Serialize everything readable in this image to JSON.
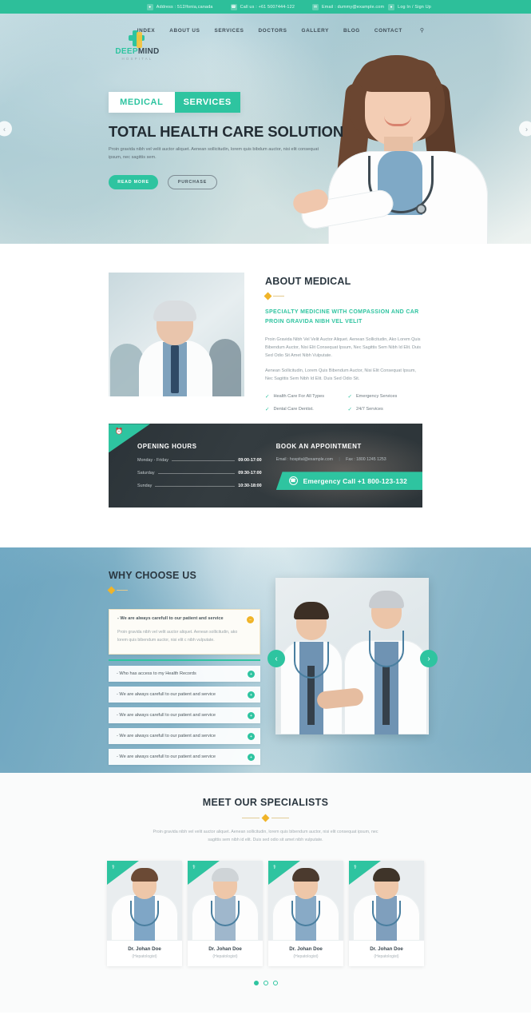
{
  "topbar": {
    "address": {
      "icon": "location-pin-icon",
      "text": "Address : 512/fonia,canada"
    },
    "phone": {
      "icon": "phone-icon",
      "text": "Call us : +61 5007444-122"
    },
    "email": {
      "icon": "envelope-icon",
      "text": "Email : dummy@example.com"
    },
    "login": {
      "icon": "user-icon",
      "text": "Log In / Sign Up"
    }
  },
  "brand": {
    "name_first": "DEEP",
    "name_second": "MIND",
    "sub": "HOSPITAL",
    "icon": "medical-cross-icon"
  },
  "nav": {
    "items": [
      {
        "label": "INDEX"
      },
      {
        "label": "ABOUT US"
      },
      {
        "label": "SERVICES"
      },
      {
        "label": "DOCTORS"
      },
      {
        "label": "GALLERY"
      },
      {
        "label": "BLOG"
      },
      {
        "label": "CONTACT"
      }
    ],
    "search_icon": "search-icon"
  },
  "hero": {
    "tag_left": "MEDICAL",
    "tag_right": "SERVICES",
    "title": "TOTAL HEALTH CARE SOLUTION",
    "paragraph": "Proin gravida nibh vel velit auctor aliquet. Aenean sollicitudin, lorem quis bibdum auctor, nisi elit consequat ipsum, nec sagittis sem.",
    "btn_primary": "READ MORE",
    "btn_secondary": "PURCHASE",
    "arrow_prev": "‹",
    "arrow_next": "›"
  },
  "about": {
    "heading": "ABOUT MEDICAL",
    "subheading": "SPECIALTY MEDICINE WITH COMPASSION AND CAR PROIN GRAVIDA NIBH VEL VELIT",
    "paragraph1": "Proin Gravida Nibh Vel Velit Auctor Aliquet. Aenean Sollicitudin, Ako Lorem Quis Bibendum Auctor, Nisi Elit Consequat Ipsum, Nec Sagittis Sem Nibh Id Elit. Duis Sed Odio Sit Amet Nibh Vulputate.",
    "paragraph2": "Aenean Sollicitudin, Lorem Quis Bibendum Auctor, Nisi Elit Consequat Ipsum, Nec Sagittis Sem Nibh Id Elit. Duis Sed Odio Sit.",
    "checks": [
      {
        "icon": "check-icon",
        "label": "Health Care For All Types"
      },
      {
        "icon": "check-icon",
        "label": "Emergency Services"
      },
      {
        "icon": "check-icon",
        "label": "Dental Care Dentist."
      },
      {
        "icon": "check-icon",
        "label": "24/7 Services"
      }
    ]
  },
  "hours": {
    "corner_icon": "clock-icon",
    "heading": "OPENING HOURS",
    "rows": [
      {
        "day": "Monday - Friday",
        "time": "09:00-17:00"
      },
      {
        "day": "Saturday",
        "time": "09:30-17:00"
      },
      {
        "day": "Sunday",
        "time": "10:30-18:00"
      }
    ],
    "appointment_heading": "BOOK AN APPOINTMENT",
    "email": "Email : hospital@example.com",
    "fax": "Fax : 1800 1245 1253",
    "emergency_icon": "phone-circle-icon",
    "emergency": "Emergency Call +1 800-123-132"
  },
  "why": {
    "heading": "WHY CHOOSE US",
    "open_item": {
      "question": "- We are always carefull to our patient and service",
      "answer": "Proin gravida nibh vel velit auctor aliquet. Aenean sollicitudin, ako lorem quis bibendum auctor, nisi elit c nibh vulputate.",
      "badge": "−"
    },
    "items": [
      {
        "question": "- Who has access to my Health Records",
        "badge": "+"
      },
      {
        "question": "- We are always carefull to our patient and service",
        "badge": "+"
      },
      {
        "question": "- We are always carefull to our patient and service",
        "badge": "+"
      },
      {
        "question": "- We are always carefull to our patient and service",
        "badge": "+"
      },
      {
        "question": "- We are always carefull to our patient and service",
        "badge": "+"
      }
    ],
    "arrow_prev": "‹",
    "arrow_next": "›"
  },
  "specialists": {
    "heading": "MEET OUR SPECIALISTS",
    "paragraph": "Proin gravida nibh vel velit auctor aliquet. Aenean sollicitudin, lorem quis bibendum auctor, nisi elit consequat ipsum, nec sagittis sem nibh id elit. Duis sed odio sit amet nibh vulputate.",
    "cards": [
      {
        "ribbon_icon": "stethoscope-icon",
        "name": "Dr. Johan Doe",
        "role": "(Hepatologist)",
        "shirt_color": "#7fa6c6",
        "hair_color": "#6b4a35"
      },
      {
        "ribbon_icon": "stethoscope-icon",
        "name": "Dr. Johan Doe",
        "role": "(Hepatologist)",
        "shirt_color": "#9fb7cc",
        "hair_color": "#cfd4d7"
      },
      {
        "ribbon_icon": "stethoscope-icon",
        "name": "Dr. Johan Doe",
        "role": "(Hepatologist)",
        "shirt_color": "#88aac6",
        "hair_color": "#4b3a2e"
      },
      {
        "ribbon_icon": "stethoscope-icon",
        "name": "Dr. Johan Doe",
        "role": "(Hepatologist)",
        "shirt_color": "#7f9fbd",
        "hair_color": "#3f3429"
      }
    ],
    "dots": [
      {
        "active": true
      },
      {
        "active": false
      },
      {
        "active": false
      }
    ]
  },
  "colors": {
    "teal": "#2ec4a0",
    "yellow": "#f0b429",
    "dark": "#2b3338",
    "heading": "#2b3740"
  }
}
